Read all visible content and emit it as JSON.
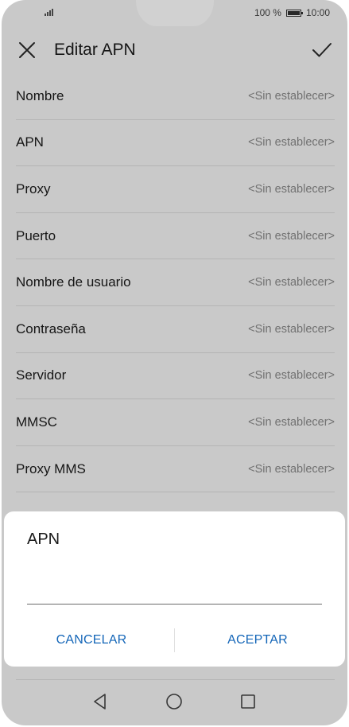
{
  "status_bar": {
    "battery_text": "100 %",
    "time": "10:00",
    "signal_icon": "signal-bars-icon",
    "battery_icon": "battery-icon"
  },
  "toolbar": {
    "title": "Editar APN",
    "close_icon": "close-icon",
    "confirm_icon": "check-icon"
  },
  "fields": [
    {
      "label": "Nombre",
      "value": "<Sin establecer>"
    },
    {
      "label": "APN",
      "value": "<Sin establecer>"
    },
    {
      "label": "Proxy",
      "value": "<Sin establecer>"
    },
    {
      "label": "Puerto",
      "value": "<Sin establecer>"
    },
    {
      "label": "Nombre de usuario",
      "value": "<Sin establecer>"
    },
    {
      "label": "Contraseña",
      "value": "<Sin establecer>"
    },
    {
      "label": "Servidor",
      "value": "<Sin establecer>"
    },
    {
      "label": "MMSC",
      "value": "<Sin establecer>"
    },
    {
      "label": "Proxy MMS",
      "value": "<Sin establecer>"
    }
  ],
  "dialog": {
    "title": "APN",
    "input_value": "",
    "cancel_label": "CANCELAR",
    "accept_label": "ACEPTAR"
  },
  "nav_bar": {
    "back_icon": "back-triangle-icon",
    "home_icon": "home-circle-icon",
    "recents_icon": "recents-square-icon"
  },
  "colors": {
    "accent": "#1466b8",
    "scrim": "rgba(0,0,0,0.18)"
  }
}
